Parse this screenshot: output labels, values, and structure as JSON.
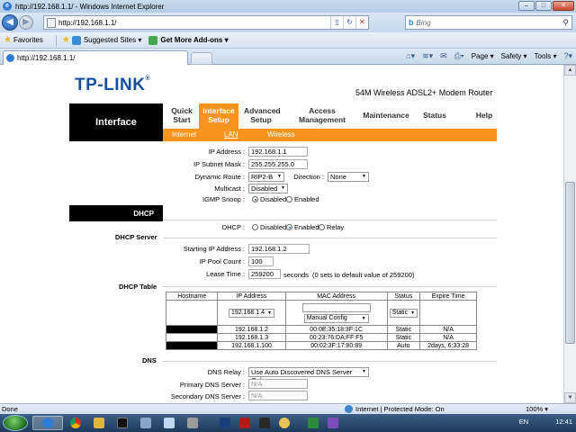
{
  "window": {
    "title": "http://192.168.1.1/ - Windows Internet Explorer"
  },
  "addressbar": {
    "url": "http://192.168.1.1/",
    "search_placeholder": "Bing"
  },
  "favorites": {
    "favorites_label": "Favorites",
    "suggested_sites": "Suggested Sites ▾",
    "get_addons": "Get More Add-ons ▾"
  },
  "tab": {
    "label": "http://192.168.1.1/"
  },
  "commandbar": {
    "page": "Page ▾",
    "safety": "Safety ▾",
    "tools": "Tools ▾"
  },
  "router": {
    "logo": "TP-LINK",
    "model": "54M Wireless ADSL2+ Modem Router",
    "section": "Interface",
    "nav": [
      {
        "label": "Quick Start"
      },
      {
        "label": "Interface Setup"
      },
      {
        "label": "Advanced Setup"
      },
      {
        "label": "Access Management"
      },
      {
        "label": "Maintenance"
      },
      {
        "label": "Status"
      },
      {
        "label": "Help"
      }
    ],
    "subnav": [
      {
        "label": "Internet"
      },
      {
        "label": "LAN"
      },
      {
        "label": "Wireless"
      }
    ],
    "lan": {
      "ip_label": "IP Address :",
      "ip_value": "192.168.1.1",
      "mask_label": "IP Subnet Mask :",
      "mask_value": "255.255.255.0",
      "route_label": "Dynamic Route :",
      "route_value": "RIP2-B",
      "direction_label": "Direction :",
      "direction_value": "None",
      "multicast_label": "Multicast :",
      "multicast_value": "Disabled",
      "igmp_label": "IGMP Snoop :",
      "igmp_disabled": "Disabled",
      "igmp_enabled": "Enabled"
    },
    "dhcp": {
      "section": "DHCP",
      "label": "DHCP :",
      "opt_disabled": "Disabled",
      "opt_enabled": "Enabled",
      "opt_relay": "Relay"
    },
    "dhcp_server": {
      "section": "DHCP Server",
      "start_label": "Starting IP Address :",
      "start_value": "192.168.1.2",
      "pool_label": "IP Pool Count :",
      "pool_value": "100",
      "lease_label": "Lease Time :",
      "lease_value": "259200",
      "lease_suffix": "seconds",
      "lease_note": "(0 sets to default value of 259200)"
    },
    "dhcp_table": {
      "section": "DHCP Table",
      "headers": [
        "Hostname",
        "IP Address",
        "MAC Address",
        "Status",
        "Expire Time"
      ],
      "input_row": {
        "ip_select": "192.168.1.4",
        "mac_select": "Manual Config",
        "status_select": "Static"
      },
      "rows": [
        {
          "ip": "192.168.1.2",
          "mac": "00:0E:35:18:3F:1C",
          "status": "Static",
          "expire": "N/A"
        },
        {
          "ip": "192.168.1.3",
          "mac": "00:23:76:DA:FF:F5",
          "status": "Static",
          "expire": "N/A"
        },
        {
          "ip": "192.168.1.100",
          "mac": "00:02:3F:17:80:89",
          "status": "Auto",
          "expire": "2days, 6:33:28"
        }
      ]
    },
    "dns": {
      "section": "DNS",
      "relay_label": "DNS Relay :",
      "relay_value": "Use Auto Discovered DNS Server Only",
      "primary_label": "Primary DNS Server :",
      "primary_value": "N/A",
      "secondary_label": "Secondary DNS Server :",
      "secondary_value": "N/A"
    }
  },
  "statusbar": {
    "left": "Done",
    "zone": "Internet | Protected Mode: On",
    "zoom": "100% ▾"
  },
  "taskbar": {
    "lang": "EN",
    "time": "12:41"
  },
  "colors": {
    "brand_orange": "#f7941d",
    "logo_blue": "#1450a0"
  }
}
